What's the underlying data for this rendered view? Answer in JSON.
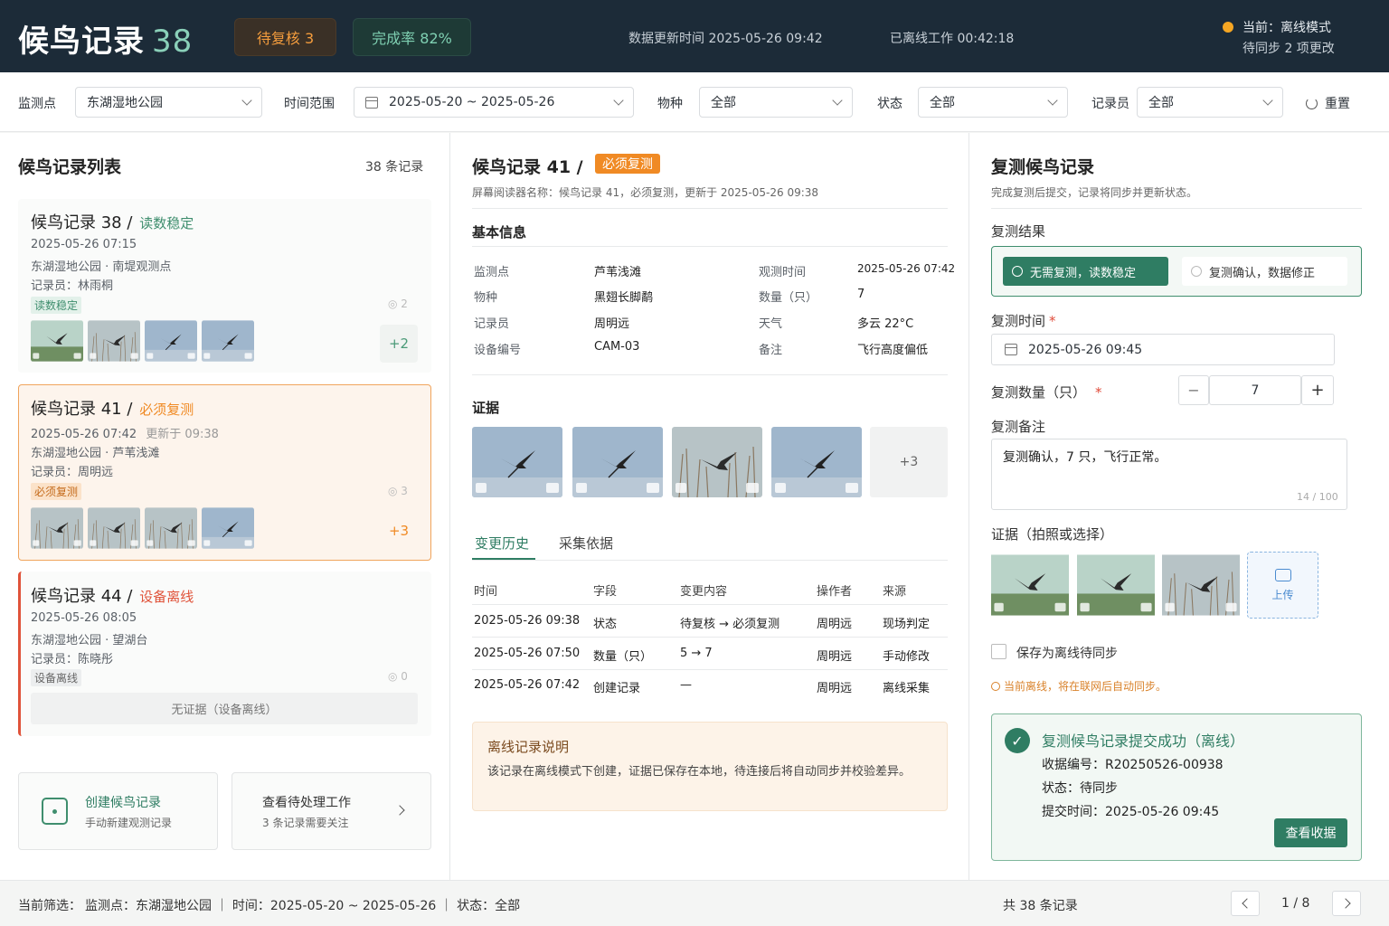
{
  "header": {
    "title": "候鸟记录",
    "title_count": "38",
    "badge_pending": "待复核 3",
    "badge_rate": "完成率 82%",
    "updated": "数据更新时间 2025-05-26 09:42",
    "offline_work": "已离线工作 00:42:18",
    "status_line1": "当前：离线模式",
    "status_line2": "待同步 2 项更改",
    "status_color": "#f5a623"
  },
  "filters": {
    "site_label": "监测点",
    "site_value": "东湖湿地公园",
    "range_label": "时间范围",
    "range_value": "2025-05-20 ~ 2025-05-26",
    "species_label": "物种",
    "species_value": "全部",
    "status_label": "状态",
    "status_value": "全部",
    "recorder_label": "记录员",
    "recorder_value": "全部",
    "reset_label": "重置"
  },
  "list": {
    "title": "候鸟记录列表",
    "count": "38 条记录",
    "cards": [
      {
        "title": "候鸟记录 38",
        "sep": "/",
        "tag": "读数稳定",
        "time": "2025-05-26 07:15",
        "updated": "",
        "location": "东湖湿地公园 · 南堤观测点",
        "recorder": "记录员：林雨桐",
        "badge": "读数稳定",
        "eye": "2",
        "more": "+2"
      },
      {
        "title": "候鸟记录 41",
        "sep": "/",
        "tag": "必须复测",
        "time": "2025-05-26 07:42",
        "updated": "更新于 09:38",
        "location": "东湖湿地公园 · 芦苇浅滩",
        "recorder": "记录员：周明远",
        "badge": "必须复测",
        "eye": "3",
        "more": "+3"
      },
      {
        "title": "候鸟记录 44",
        "sep": "/",
        "tag": "设备离线",
        "time": "2025-05-26 08:05",
        "updated": "",
        "location": "东湖湿地公园 · 望湖台",
        "recorder": "记录员：陈晓彤",
        "badge": "设备离线",
        "eye": "0",
        "no_evidence": "无证据（设备离线）"
      }
    ],
    "action_create_title": "创建候鸟记录",
    "action_create_sub": "手动新建观测记录",
    "action_pending_title": "查看待处理工作",
    "action_pending_sub": "3 条记录需要关注"
  },
  "detail": {
    "title": "候鸟记录 41 /",
    "tag": "必须复测",
    "subtitle": "屏幕阅读器名称：候鸟记录 41，必须复测，更新于 2025-05-26 09:38",
    "basic_title": "基本信息",
    "rows": [
      {
        "l1": "监测点",
        "v1": "芦苇浅滩",
        "l2": "观测时间",
        "v2": "2025-05-26 07:42"
      },
      {
        "l1": "物种",
        "v1": "黑翅长脚鹬",
        "l2": "数量（只）",
        "v2": "7"
      },
      {
        "l1": "记录员",
        "v1": "周明远",
        "l2": "天气",
        "v2": "多云 22°C"
      },
      {
        "l1": "设备编号",
        "v1": "CAM-03",
        "l2": "备注",
        "v2": "飞行高度偏低"
      }
    ],
    "evidence_title": "证据",
    "evidence_more": "+3",
    "tab_history": "变更历史",
    "tab_basis": "采集依据",
    "history_headers": [
      "时间",
      "字段",
      "变更内容",
      "操作者",
      "来源"
    ],
    "history": [
      [
        "2025-05-26 09:38",
        "状态",
        "待复核 → 必须复测",
        "周明远",
        "现场判定"
      ],
      [
        "2025-05-26 07:50",
        "数量（只）",
        "5 → 7",
        "周明远",
        "手动修改"
      ],
      [
        "2025-05-26 07:42",
        "创建记录",
        "—",
        "周明远",
        "离线采集"
      ]
    ],
    "offline_title": "离线记录说明",
    "offline_text": "该记录在离线模式下创建，证据已保存在本地，待连接后将自动同步并校验差异。"
  },
  "recheck": {
    "title": "复测候鸟记录",
    "subtitle": "完成复测后提交，记录将同步并更新状态。",
    "result_label": "复测结果",
    "option1": "无需复测，读数稳定",
    "option2": "复测确认，数据修正",
    "time_label": "复测时间",
    "time_value": "2025-05-26 09:45",
    "count_label": "复测数量（只）",
    "count_value": "7",
    "minus": "−",
    "plus": "+",
    "note_label": "复测备注",
    "note_value": "复测确认，7 只，飞行正常。",
    "note_counter": "14 / 100",
    "evidence_label": "证据（拍照或选择）",
    "upload": "上传",
    "save_offline": "保存为离线待同步",
    "offline_hint": "当前离线，将在联网后自动同步。",
    "success_title": "复测候鸟记录提交成功（离线）",
    "receipt": "收据编号：R20250526-00938",
    "state": "状态：待同步",
    "submitted": "提交时间：2025-05-26 09:45",
    "view_receipt": "查看收据"
  },
  "footer": {
    "filters_label": "当前筛选：",
    "filters_value": "监测点：东湖湿地公园 ｜ 时间：2025-05-20 ~ 2025-05-26 ｜ 状态：全部",
    "total": "共 38 条记录",
    "page": "1 / 8"
  },
  "colors": {
    "accent": "#2f7d63",
    "warn": "#f08a24",
    "danger": "#e0533a",
    "header_bg": "#1c2b38"
  }
}
